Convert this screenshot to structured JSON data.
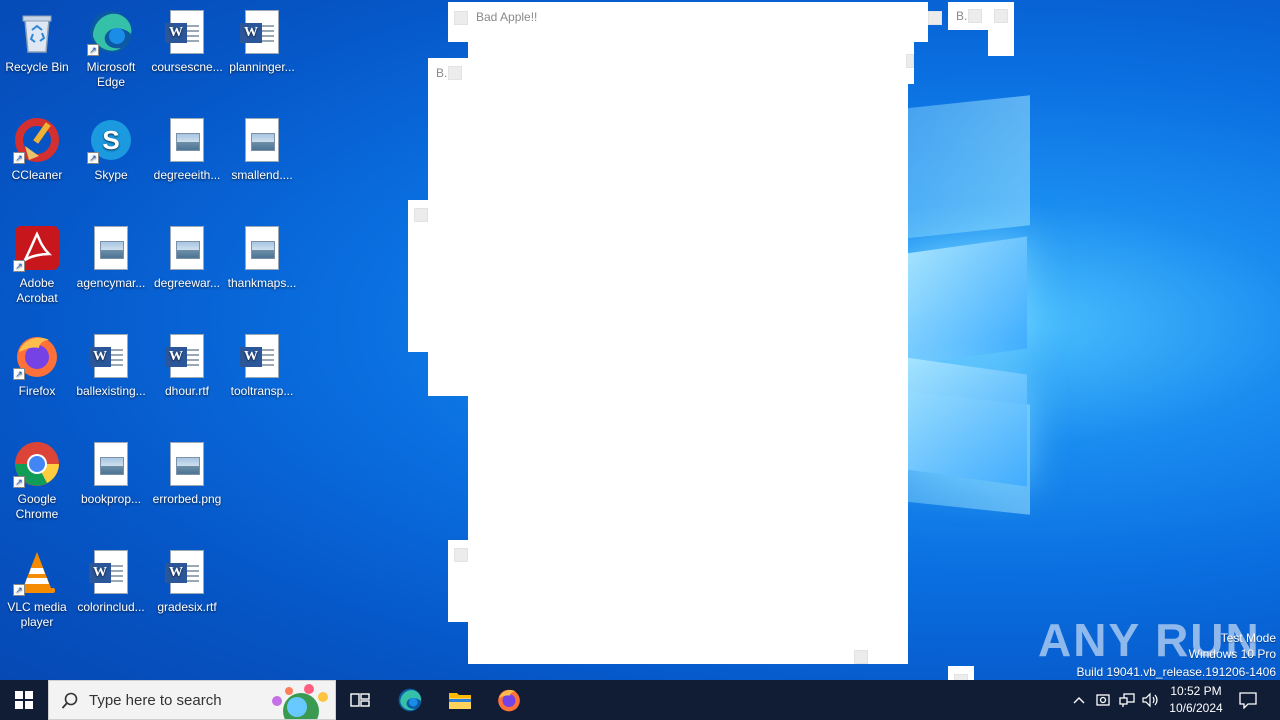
{
  "desktop": {
    "icons": [
      {
        "label": "Recycle Bin"
      },
      {
        "label": "Microsoft Edge"
      },
      {
        "label": "coursescne..."
      },
      {
        "label": "planninger..."
      },
      {
        "label": "CCleaner"
      },
      {
        "label": "Skype"
      },
      {
        "label": "degreeeith..."
      },
      {
        "label": "smallend...."
      },
      {
        "label": "Adobe Acrobat"
      },
      {
        "label": "agencymar..."
      },
      {
        "label": "degreewar..."
      },
      {
        "label": "thankmaps..."
      },
      {
        "label": "Firefox"
      },
      {
        "label": "ballexisting..."
      },
      {
        "label": "dhour.rtf"
      },
      {
        "label": "tooltransp..."
      },
      {
        "label": "Google Chrome"
      },
      {
        "label": "bookprop..."
      },
      {
        "label": "errorbed.png"
      },
      {
        "label": "VLC media player"
      },
      {
        "label": "colorinclud..."
      },
      {
        "label": "gradesix.rtf"
      }
    ]
  },
  "windows": {
    "main_title": "Bad Apple!!",
    "small_title_a": "B.",
    "small_title_b": "B."
  },
  "taskbar": {
    "search_placeholder": "Type here to search",
    "time": "10:52 PM",
    "date": "10/6/2024"
  },
  "watermark": {
    "brand": "ANY RUN",
    "line1": "Test Mode",
    "line2": "Windows 10 Pro",
    "line3": "Build 19041.vb_release.191206-1406"
  },
  "colors": {
    "desktop_bg": "#0a6fe0",
    "taskbar_bg": "#101d35",
    "word_blue": "#2b579a"
  }
}
